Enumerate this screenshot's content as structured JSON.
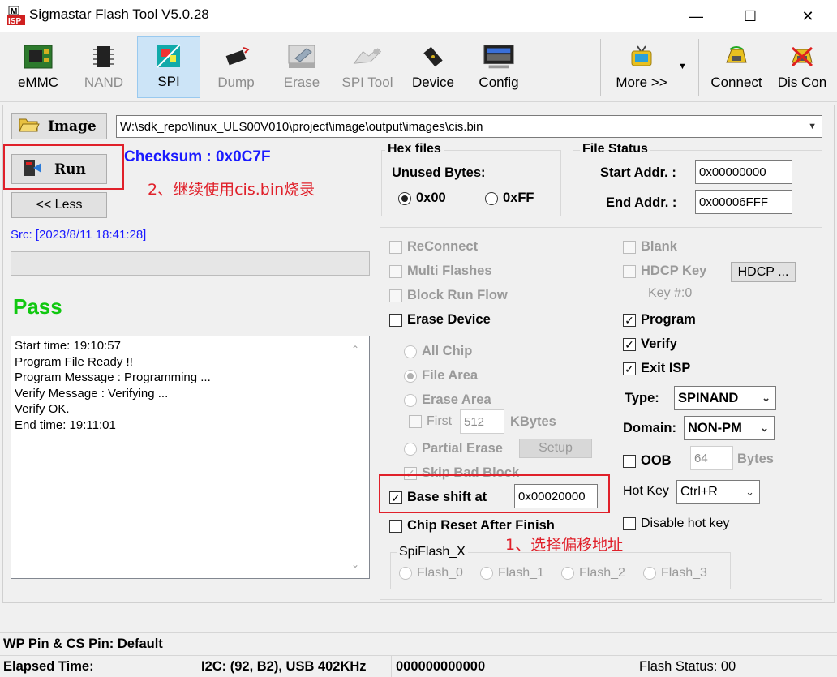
{
  "window": {
    "title": "Sigmastar Flash Tool V5.0.28",
    "minimize": "—",
    "maximize": "☐",
    "close": "✕"
  },
  "toolbar": {
    "emmc": "eMMC",
    "nand": "NAND",
    "spi": "SPI",
    "dump": "Dump",
    "erase": "Erase",
    "spi_tool": "SPI Tool",
    "device": "Device",
    "config": "Config",
    "more": "More >>",
    "connect": "Connect",
    "dis_con": "Dis Con"
  },
  "image": {
    "button": "Image",
    "path": "W:\\sdk_repo\\linux_ULS00V010\\project\\image\\output\\images\\cis.bin"
  },
  "run": {
    "button": "Run",
    "less": "<< Less",
    "checksum": "Checksum : 0x0C7F"
  },
  "src": "Src: [2023/8/11 18:41:28]",
  "result": "Pass",
  "log": [
    "Start time: 19:10:57",
    "Program File Ready !!",
    "Program Message : Programming ...",
    "Verify Message : Verifying ...",
    "Verify OK.",
    "End time: 19:11:01"
  ],
  "hex_files": {
    "title": "Hex files",
    "unused_bytes": "Unused Bytes:",
    "opt_00": "0x00",
    "opt_ff": "0xFF"
  },
  "file_status": {
    "title": "File Status",
    "start_label": "Start Addr. :",
    "start_value": "0x00000000",
    "end_label": "End Addr. :",
    "end_value": "0x00006FFF"
  },
  "options": {
    "reconnect": "ReConnect",
    "multi_flashes": "Multi Flashes",
    "block_run_flow": "Block Run Flow",
    "erase_device": "Erase Device",
    "all_chip": "All Chip",
    "file_area": "File Area",
    "erase_area": "Erase Area",
    "first": "First",
    "first_value": "512",
    "kbytes": "KBytes",
    "partial_erase": "Partial Erase",
    "setup": "Setup",
    "skip_bad_block": "Skip Bad Block",
    "base_shift": "Base shift at",
    "base_shift_value": "0x00020000",
    "chip_reset": "Chip Reset After Finish",
    "blank": "Blank",
    "hdcp_key": "HDCP Key",
    "hdcp_btn": "HDCP ...",
    "key_num": "Key #:0",
    "program": "Program",
    "verify": "Verify",
    "exit_isp": "Exit ISP",
    "type_label": "Type:",
    "type_value": "SPINAND",
    "domain_label": "Domain:",
    "domain_value": "NON-PM",
    "oob": "OOB",
    "oob_value": "64",
    "bytes": "Bytes",
    "hot_key_label": "Hot Key",
    "hot_key_value": "Ctrl+R",
    "disable_hot_key": "Disable hot key"
  },
  "spiflash": {
    "title": "SpiFlash_X",
    "flash0": "Flash_0",
    "flash1": "Flash_1",
    "flash2": "Flash_2",
    "flash3": "Flash_3"
  },
  "annotations": {
    "note1": "1、选择偏移地址",
    "note2": "2、继续使用cis.bin烧录"
  },
  "status": {
    "wp_pin": "WP Pin & CS Pin: Default",
    "elapsed": "Elapsed Time:",
    "i2c": "I2C: (92, B2), USB  402KHz",
    "serial": "000000000000",
    "flash_status": "Flash Status: 00"
  },
  "colors": {
    "checksum": "#1a1aff",
    "pass": "#10c810",
    "src": "#1a1aff",
    "annotation": "#e0202a"
  }
}
